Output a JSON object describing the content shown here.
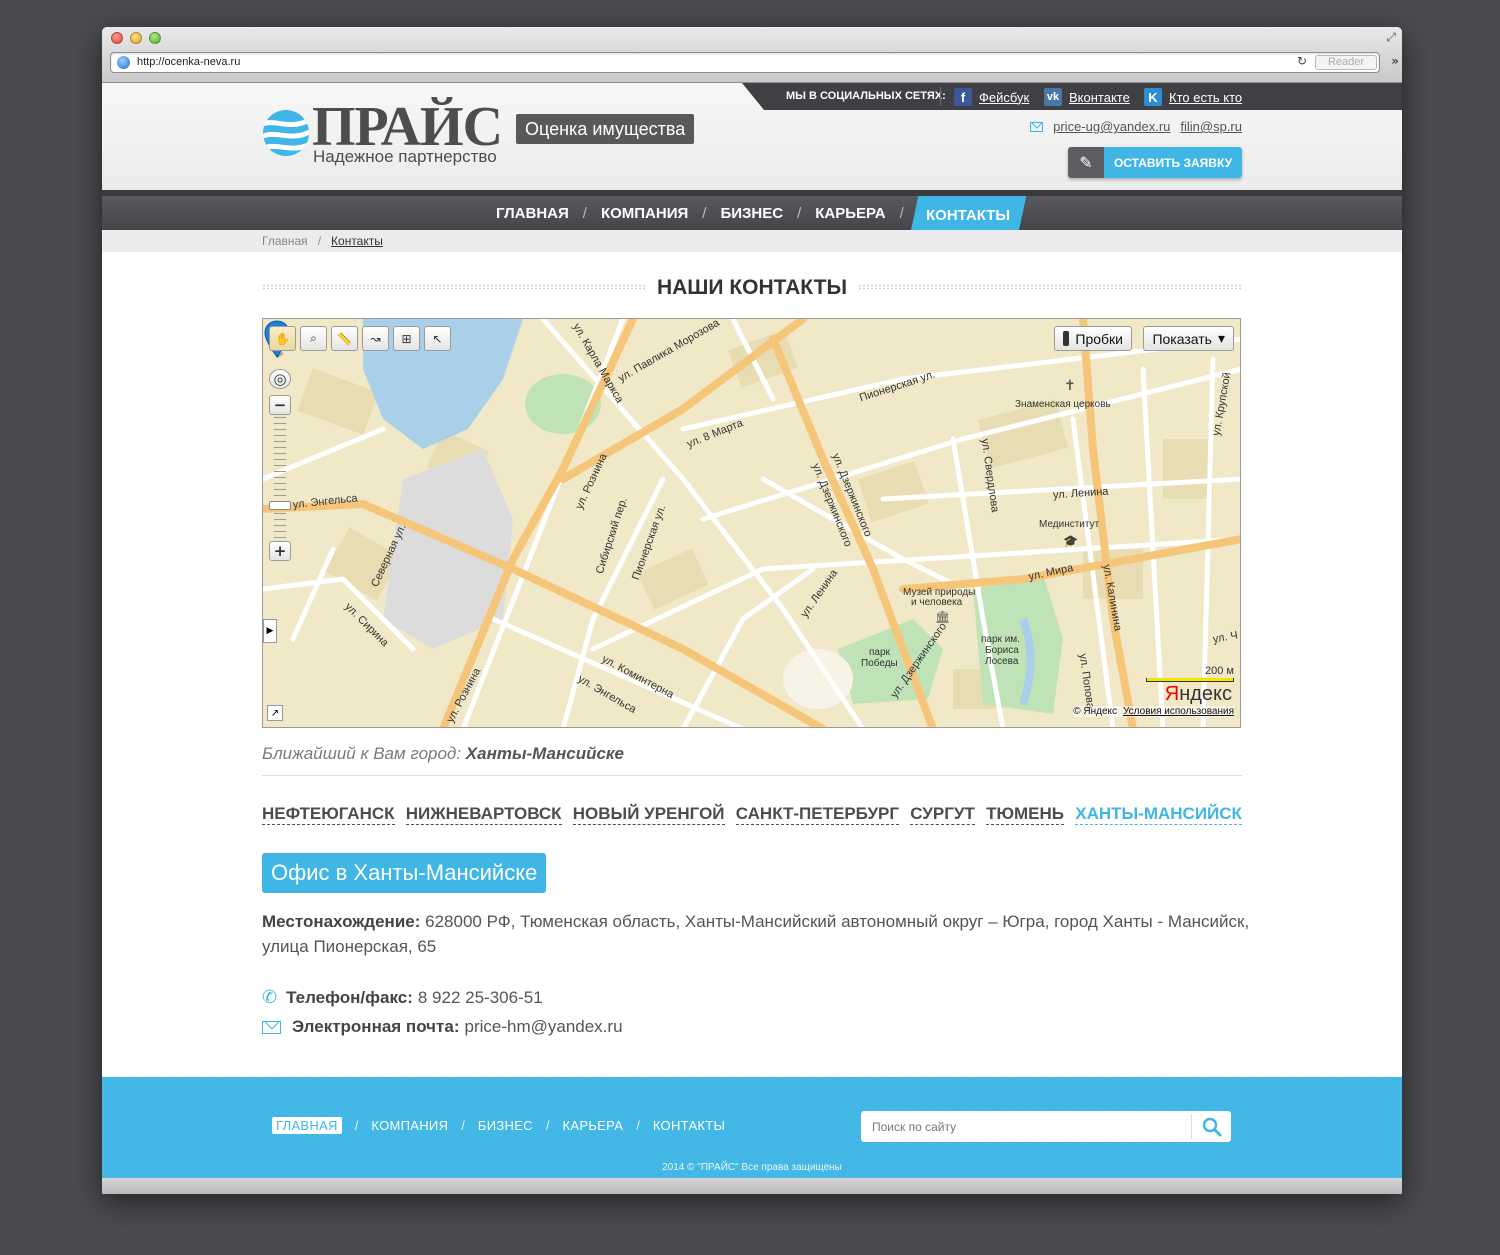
{
  "browser": {
    "url": "http://ocenka-neva.ru",
    "reader_label": "Reader"
  },
  "header": {
    "social_label": "МЫ В СОЦИАЛЬНЫХ СЕТЯХ:",
    "social": [
      {
        "icon": "facebook-icon",
        "glyph": "f",
        "label": "Фейсбук"
      },
      {
        "icon": "vkontakte-icon",
        "glyph": "vk",
        "label": "Вконтакте"
      },
      {
        "icon": "kto-est-kto-icon",
        "glyph": "K",
        "label": "Кто есть кто"
      }
    ],
    "logo_title": "ПРАЙС",
    "logo_tag": "Оценка имущества",
    "logo_subtitle": "Надежное партнерство",
    "emails": [
      "price-ug@yandex.ru",
      "filin@sp.ru"
    ],
    "request_button": "ОСТАВИТЬ ЗАЯВКУ"
  },
  "nav": {
    "items": [
      "ГЛАВНАЯ",
      "КОМПАНИЯ",
      "БИЗНЕС",
      "КАРЬЕРА",
      "КОНТАКТЫ"
    ],
    "active": "КОНТАКТЫ",
    "separator": "/"
  },
  "breadcrumb": {
    "items": [
      "Главная",
      "Контакты"
    ],
    "separator": "/"
  },
  "contacts": {
    "title": "НАШИ КОНТАКТЫ",
    "nearest_label": "Ближайший к Вам город:",
    "nearest_city": "Ханты-Мансийске",
    "cities": [
      "НЕФТЕЮГАНСК",
      "НИЖНЕВАРТОВСК",
      "НОВЫЙ УРЕНГОЙ",
      "САНКТ-ПЕТЕРБУРГ",
      "СУРГУТ",
      "ТЮМЕНЬ",
      "ХАНТЫ-МАНСИЙСК"
    ],
    "active_city": "ХАНТЫ-МАНСИЙСК",
    "office_title": "Офис в Ханты-Мансийске",
    "address_label": "Местонахождение:",
    "address_value": "628000 РФ, Тюменская область, Ханты-Мансийский автономный округ – Югра, город Ханты - Мансийск, улица Пионерская, 65",
    "phone_label": "Телефон/факс:",
    "phone_value": "8 922 25-306-51",
    "email_label": "Электронная почта:",
    "email_value": "price-hm@yandex.ru"
  },
  "map": {
    "traffic_button": "Пробки",
    "show_button": "Показать",
    "scale_label": "200 м",
    "logo": "Яндекс",
    "copyright": "© Яндекс",
    "terms": "Условия использования",
    "streets": {
      "engelsa": "ул. Энгельса",
      "rozina": "ул. Рознина",
      "dzerzhinskogo": "ул. Дзержинского",
      "pionerskaya": "Пионерская ул.",
      "pionerskaya2": "Пионерская ул.",
      "sverdlova": "ул. Свердлова",
      "lenina": "ул. Ленина",
      "lenina2": "ул. Ленина",
      "mira": "ул. Мира",
      "kalinina": "ул. Калинина",
      "komintern": "ул. Коминтерна",
      "sibirsky": "Сибирский пер.",
      "marksa": "ул. Карла Маркса",
      "morozova": "ул. Павлика Морозова",
      "march8": "ул. 8 Марта",
      "severnaya": "Северная ул.",
      "sirina": "ул. Сирина",
      "krupskoy": "ул. Крупской",
      "popova": "ул. Попова",
      "chekhova": "ул. Ч"
    },
    "pois": {
      "church": "Знаменская церковь",
      "medinstitute": "Мединститут",
      "museum_1": "Музей природы",
      "museum_2": "и человека",
      "park_pobedy_1": "парк",
      "park_pobedy_2": "Победы",
      "park_loseva_1": "парк им.",
      "park_loseva_2": "Бориса",
      "park_loseva_3": "Лосева"
    }
  },
  "footer": {
    "nav": [
      "ГЛАВНАЯ",
      "КОМПАНИЯ",
      "БИЗНЕС",
      "КАРЬЕРА",
      "КОНТАКТЫ"
    ],
    "active": "ГЛАВНАЯ",
    "separator": "/",
    "search_placeholder": "Поиск по сайту",
    "copyright": "2014 © \"ПРАЙС\" Все права защищены"
  },
  "colors": {
    "accent": "#3fb6e6",
    "dark": "#4a4b4e",
    "text": "#555555"
  }
}
